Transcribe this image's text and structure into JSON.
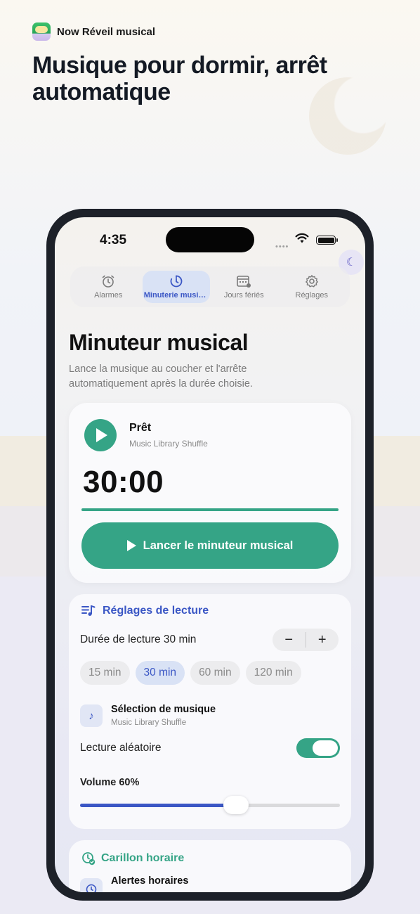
{
  "header": {
    "app_name": "Now Réveil musical",
    "headline": "Musique pour dormir, arrêt automatique"
  },
  "status_bar": {
    "time": "4:35"
  },
  "tabs": [
    {
      "label": "Alarmes",
      "icon": "alarm-clock-icon",
      "active": false
    },
    {
      "label": "Minuterie musicale",
      "icon": "timer-icon",
      "active": true
    },
    {
      "label": "Jours fériés",
      "icon": "calendar-icon",
      "active": false
    },
    {
      "label": "Réglages",
      "icon": "gear-icon",
      "active": false
    }
  ],
  "page": {
    "title": "Minuteur musical",
    "subtitle": "Lance la musique au coucher et l'arrête automatiquement après la durée choisie."
  },
  "player": {
    "status": "Prêt",
    "source": "Music Library Shuffle",
    "countdown": "30:00",
    "progress": 1.0,
    "start_label": "Lancer le minuteur musical"
  },
  "playback": {
    "section_title": "Réglages de lecture",
    "duration_label": "Durée de lecture 30 min",
    "stepper_minus": "−",
    "stepper_plus": "+",
    "chips": [
      "15 min",
      "30 min",
      "60 min",
      "120 min"
    ],
    "selected_chip": "30 min",
    "music_title": "Sélection de musique",
    "music_source": "Music Library Shuffle",
    "shuffle_label": "Lecture aléatoire",
    "shuffle_on": true,
    "volume_label": "Volume 60%",
    "volume": 0.6
  },
  "chime": {
    "section_title": "Carillon horaire",
    "alerts_title": "Alertes horaires"
  },
  "colors": {
    "accent_green": "#35a486",
    "accent_blue": "#3b57c5",
    "tab_active_bg": "#d9e2f5"
  }
}
